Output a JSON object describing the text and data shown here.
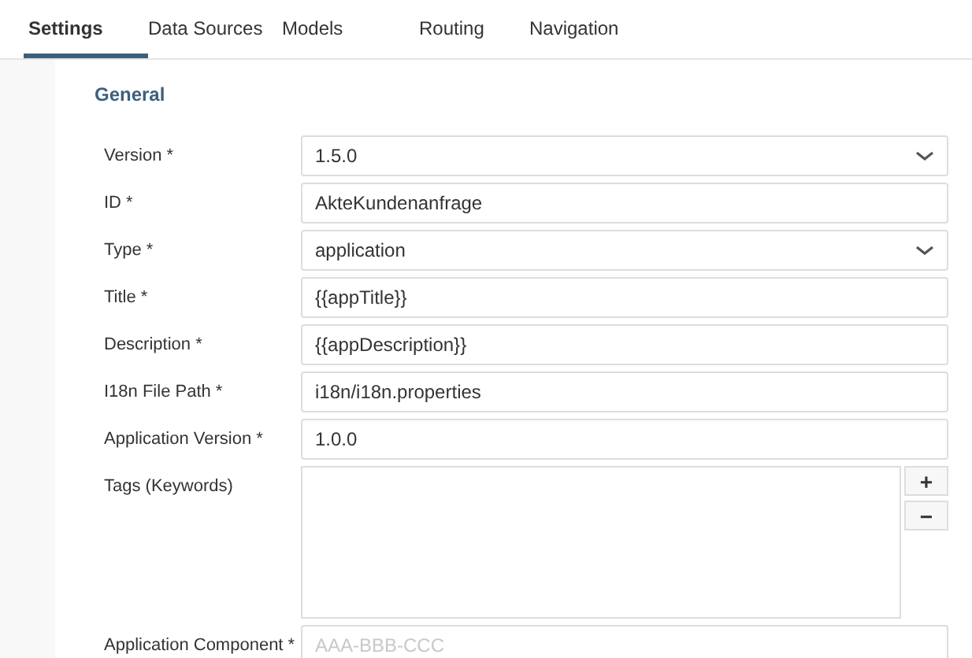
{
  "tabs": [
    {
      "label": "Settings",
      "selected": true
    },
    {
      "label": "Data Sources",
      "selected": false
    },
    {
      "label": "Models",
      "selected": false
    },
    {
      "label": "Routing",
      "selected": false
    },
    {
      "label": "Navigation",
      "selected": false
    }
  ],
  "section": {
    "title": "General"
  },
  "fields": [
    {
      "label": "Version *",
      "kind": "select",
      "value": "1.5.0"
    },
    {
      "label": "ID *",
      "kind": "text",
      "value": "AkteKundenanfrage"
    },
    {
      "label": "Type *",
      "kind": "select",
      "value": "application"
    },
    {
      "label": "Title *",
      "kind": "text",
      "value": "{{appTitle}}"
    },
    {
      "label": "Description *",
      "kind": "text",
      "value": "{{appDescription}}"
    },
    {
      "label": "I18n File Path *",
      "kind": "text",
      "value": "i18n/i18n.properties"
    },
    {
      "label": "Application Version *",
      "kind": "text",
      "value": "1.0.0"
    },
    {
      "label": "Tags (Keywords)",
      "kind": "list",
      "buttons": [
        "+",
        "−"
      ]
    },
    {
      "label": "Application Component *",
      "kind": "text",
      "placeholder": "AAA-BBB-CCC"
    }
  ]
}
